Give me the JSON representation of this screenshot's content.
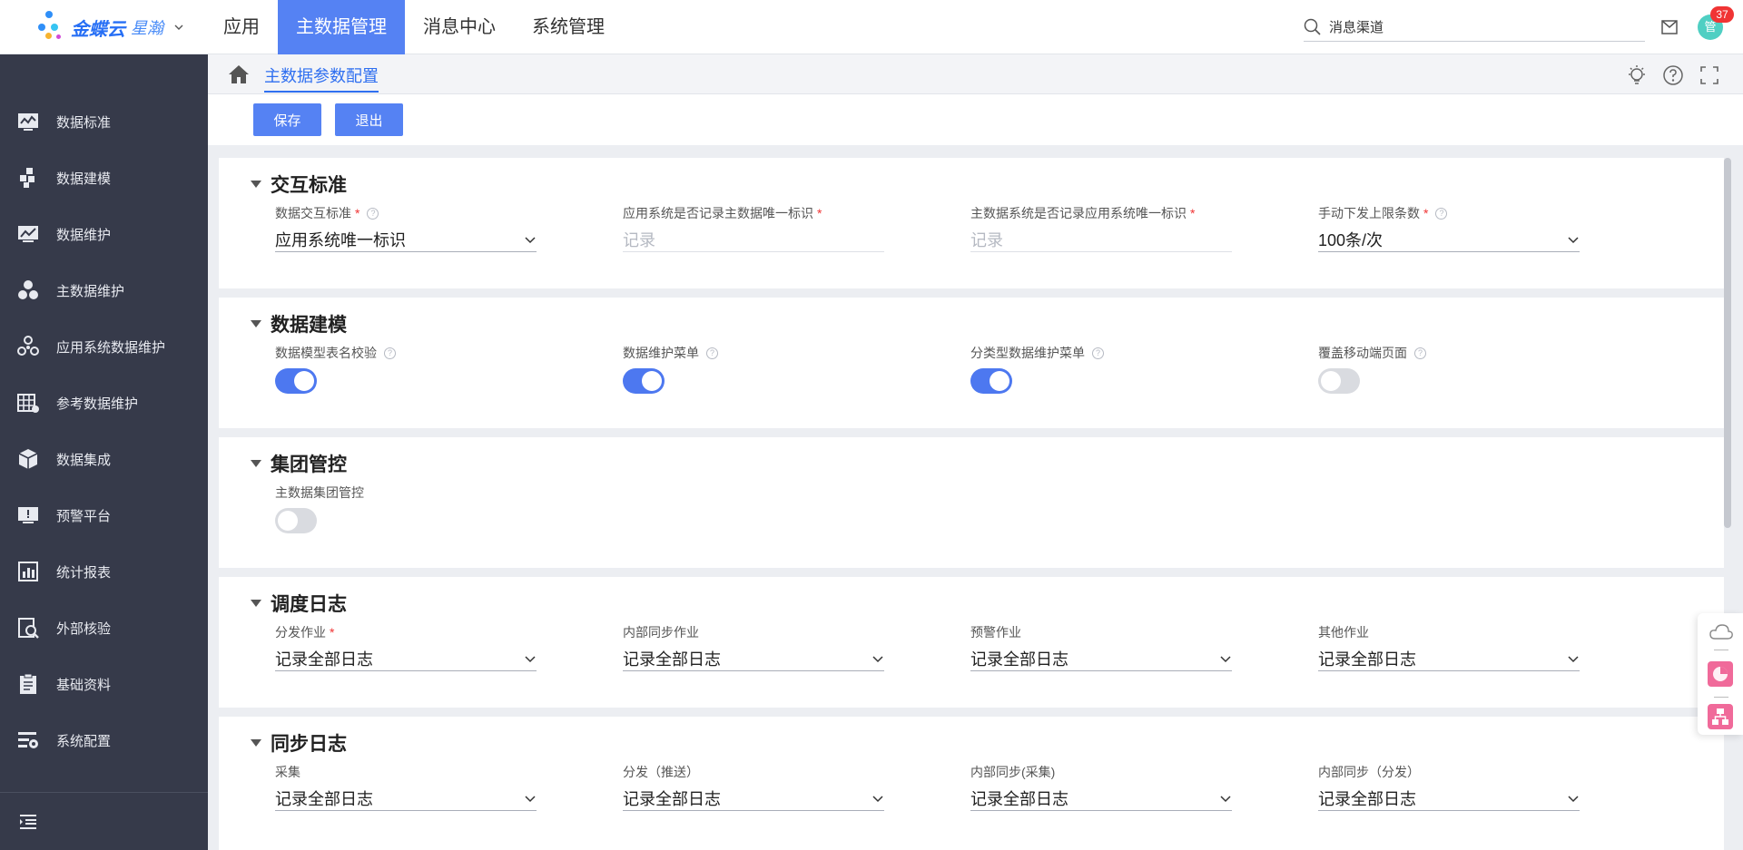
{
  "brand": {
    "name": "金蝶云",
    "product": "星瀚"
  },
  "topnav": [
    {
      "label": "应用",
      "active": false
    },
    {
      "label": "主数据管理",
      "active": true
    },
    {
      "label": "消息中心",
      "active": false
    },
    {
      "label": "系统管理",
      "active": false
    }
  ],
  "search": {
    "value": "消息渠道"
  },
  "user": {
    "avatar_text": "管",
    "notifications": "37"
  },
  "sidebar": {
    "items": [
      {
        "label": "数据标准",
        "icon": "chart-icon"
      },
      {
        "label": "数据建模",
        "icon": "blocks-icon"
      },
      {
        "label": "数据维护",
        "icon": "monitor-icon"
      },
      {
        "label": "主数据维护",
        "icon": "circles-icon"
      },
      {
        "label": "应用系统数据维护",
        "icon": "nodes-icon"
      },
      {
        "label": "参考数据维护",
        "icon": "table-icon"
      },
      {
        "label": "数据集成",
        "icon": "cube-icon"
      },
      {
        "label": "预警平台",
        "icon": "alert-monitor-icon"
      },
      {
        "label": "统计报表",
        "icon": "report-icon"
      },
      {
        "label": "外部核验",
        "icon": "verify-icon"
      },
      {
        "label": "基础资料",
        "icon": "clipboard-icon"
      },
      {
        "label": "系统配置",
        "icon": "settings-list-icon"
      }
    ]
  },
  "breadcrumb": {
    "current": "主数据参数配置"
  },
  "toolbar": {
    "save_label": "保存",
    "exit_label": "退出"
  },
  "sections": {
    "interaction": {
      "title": "交互标准",
      "fields": [
        {
          "label": "数据交互标准",
          "required": true,
          "help": true,
          "value": "应用系统唯一标识",
          "placeholder": false,
          "dropdown": true
        },
        {
          "label": "应用系统是否记录主数据唯一标识",
          "required": true,
          "help": false,
          "value": "记录",
          "placeholder": true,
          "dropdown": false
        },
        {
          "label": "主数据系统是否记录应用系统唯一标识",
          "required": true,
          "help": false,
          "value": "记录",
          "placeholder": true,
          "dropdown": false
        },
        {
          "label": "手动下发上限条数",
          "required": true,
          "help": true,
          "value": "100条/次",
          "placeholder": false,
          "dropdown": true
        }
      ]
    },
    "modeling": {
      "title": "数据建模",
      "toggles": [
        {
          "label": "数据模型表名校验",
          "on": true
        },
        {
          "label": "数据维护菜单",
          "on": true
        },
        {
          "label": "分类型数据维护菜单",
          "on": true
        },
        {
          "label": "覆盖移动端页面",
          "on": false
        }
      ]
    },
    "group": {
      "title": "集团管控",
      "toggles": [
        {
          "label": "主数据集团管控",
          "on": false
        }
      ]
    },
    "schedule_log": {
      "title": "调度日志",
      "fields": [
        {
          "label": "分发作业",
          "required": true,
          "value": "记录全部日志"
        },
        {
          "label": "内部同步作业",
          "required": false,
          "value": "记录全部日志"
        },
        {
          "label": "预警作业",
          "required": false,
          "value": "记录全部日志"
        },
        {
          "label": "其他作业",
          "required": false,
          "value": "记录全部日志"
        }
      ]
    },
    "sync_log": {
      "title": "同步日志",
      "fields": [
        {
          "label": "采集",
          "required": false,
          "value": "记录全部日志"
        },
        {
          "label": "分发（推送）",
          "required": false,
          "value": "记录全部日志"
        },
        {
          "label": "内部同步(采集)",
          "required": false,
          "value": "记录全部日志"
        },
        {
          "label": "内部同步（分发）",
          "required": false,
          "value": "记录全部日志"
        }
      ]
    }
  },
  "colors": {
    "accent": "#5582f3",
    "sidebar": "#363a4a",
    "required": "#f03434"
  }
}
